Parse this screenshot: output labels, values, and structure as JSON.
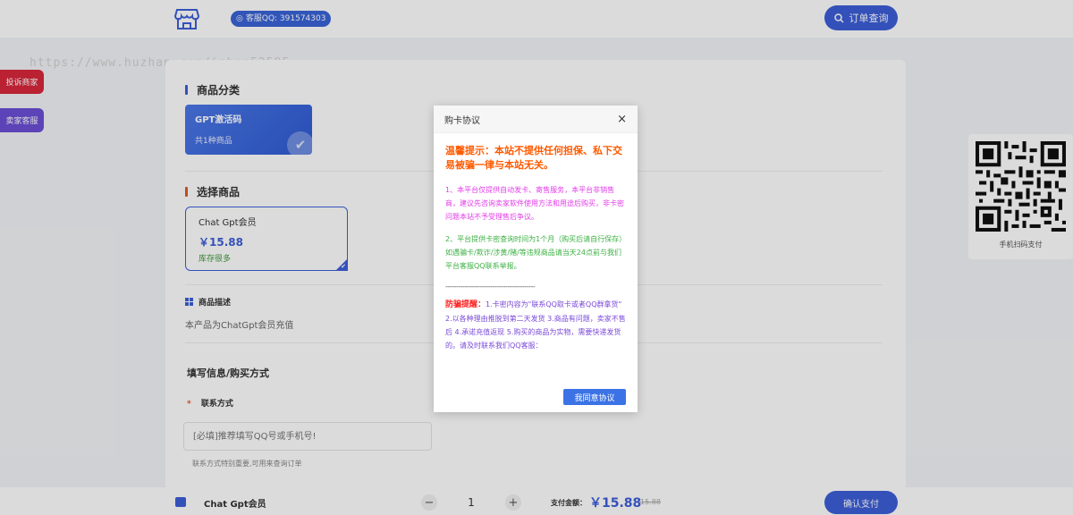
{
  "header": {
    "qq_badge": "客服QQ: 391574303",
    "order_query_label": "订单查询"
  },
  "watermark": "https://www.huzhan.com/ishop52595",
  "side_buttons": {
    "complain": "投诉商家",
    "service": "卖家客服"
  },
  "category": {
    "section_title": "商品分类",
    "card_name": "GPT激活码",
    "card_count": "共1种商品"
  },
  "product": {
    "section_title": "选择商品",
    "name": "Chat Gpt会员",
    "price": "￥15.88",
    "stock": "库存很多"
  },
  "description": {
    "title": "商品描述",
    "text": "本产品为ChatGpt会员充值"
  },
  "form": {
    "title": "填写信息/购买方式",
    "contact_label": "联系方式",
    "contact_star": "*",
    "contact_placeholder": "[必填]推荐填写QQ号或手机号!",
    "contact_hint": "联系方式特别重要,可用来查询订单"
  },
  "qr": {
    "label": "手机扫码支付"
  },
  "bottom": {
    "product_name": "Chat Gpt会员",
    "quantity": "1",
    "minus": "−",
    "plus": "+",
    "pay_label": "支付金额：",
    "pay_amount": "￥15.88",
    "old_price": "15.88",
    "confirm_label": "确认支付"
  },
  "modal": {
    "title": "购卡协议",
    "close": "×",
    "warning": "温馨提示：本站不提供任何担保、私下交易被骗一律与本站无关。",
    "para1": "1、本平台仅提供自动发卡、寄售服务，本平台非销售商，建议先咨询卖家软件使用方法和用途后购买，非卡密问题本站不予受理售后争议。",
    "para2": "2、平台提供卡密查询时间为1个月（购买后请自行保存）如遇骗卡/欺诈/涉黄/赌/等违规商品请当天24点前与我们平台客服QQ联系举报。",
    "separator": "------------------------------------------",
    "fraud_label": "防骗提醒：",
    "para3": "1.卡密内容为\"联系QQ取卡或者QQ群拿货\" 2.以各种理由推脱到第二天发货 3.商品有问题，卖家不售后 4.承诺充值返现 5.购买的商品为实物，需要快递发货的。请及时联系我们QQ客服：",
    "agree_label": "我同意协议"
  },
  "colors": {
    "accent": "#3d5fd9",
    "warning": "#ff5a00",
    "complain": "#d9273b",
    "service": "#6c4fd6"
  }
}
